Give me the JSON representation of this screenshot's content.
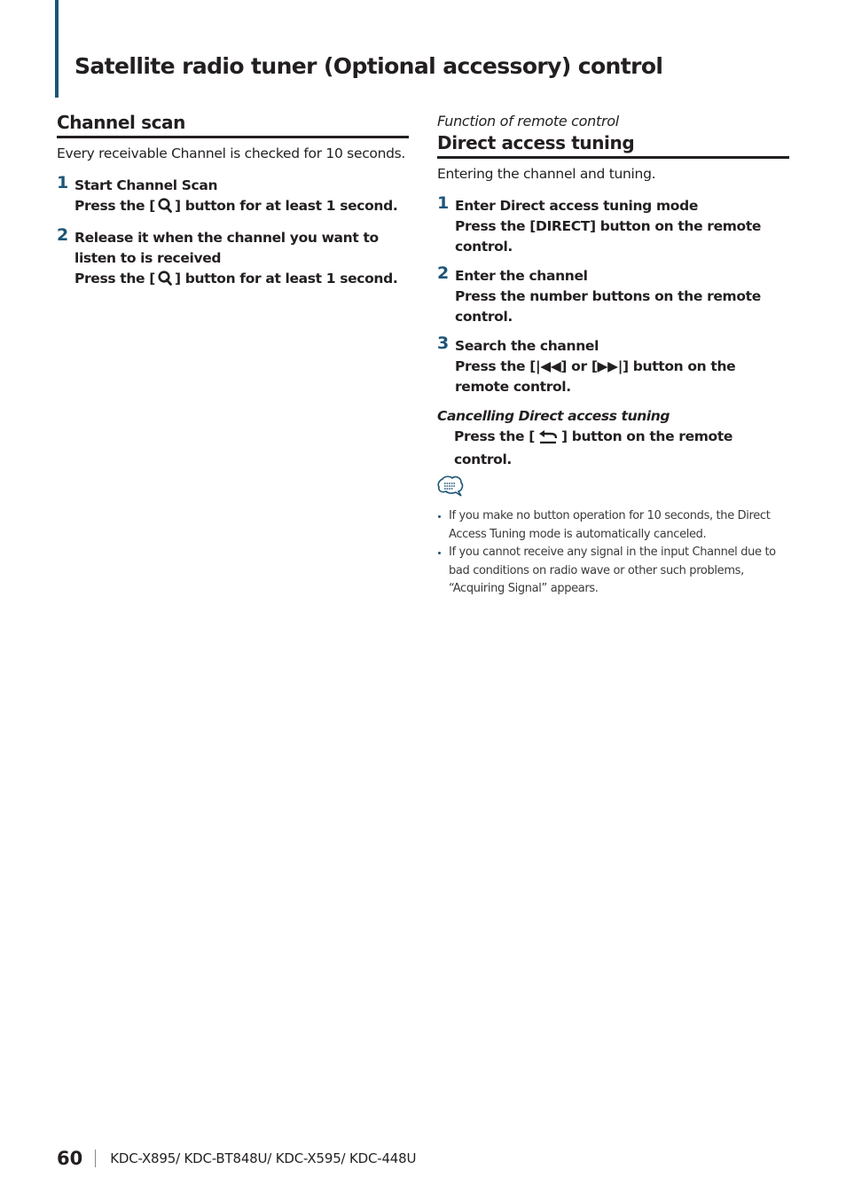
{
  "page_title": "Satellite radio tuner (Optional accessory) control",
  "channel_scan": {
    "heading": "Channel scan",
    "lead": "Every receivable Channel is checked for 10 seconds.",
    "steps": [
      {
        "num": "1",
        "title": "Start Channel Scan",
        "body_before": "Press the [",
        "icon": "search-icon",
        "body_after": "] button for at least 1 second."
      },
      {
        "num": "2",
        "title": "Release it when the channel you want to listen to is received",
        "body_before": "Press the [",
        "icon": "search-icon",
        "body_after": "] button for at least 1 second."
      }
    ]
  },
  "direct_access": {
    "kicker": "Function of remote control",
    "heading": "Direct access tuning",
    "lead": "Entering the channel and tuning.",
    "steps": [
      {
        "num": "1",
        "title": "Enter Direct access tuning mode",
        "body": "Press the [DIRECT] button on the remote control."
      },
      {
        "num": "2",
        "title": "Enter the channel",
        "body": "Press the number buttons on the remote control."
      },
      {
        "num": "3",
        "title": "Search the channel",
        "body": "Press the [|◀◀] or [▶▶|] button on the remote control."
      }
    ],
    "cancel": {
      "heading": "Cancelling Direct access tuning",
      "body_before": "Press the [",
      "icon": "return-icon",
      "body_after": "] button on the remote control."
    },
    "note_icon": "note-speech-bubble-icon",
    "notes": [
      "If you make no button operation for 10 seconds, the Direct Access Tuning mode is automatically canceled.",
      "If you cannot receive any signal in the input Channel due to bad conditions on radio wave or other such problems, “Acquiring Signal” appears."
    ]
  },
  "footer": {
    "page_number": "60",
    "models": "KDC-X895/ KDC-BT848U/ KDC-X595/ KDC-448U"
  },
  "colors": {
    "accent": "#1d5577",
    "text": "#231f20"
  }
}
